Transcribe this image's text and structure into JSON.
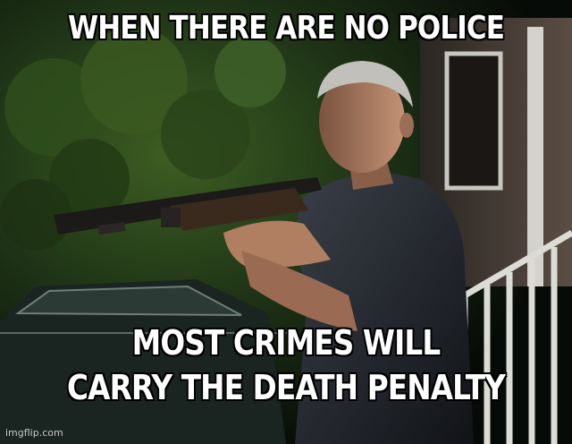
{
  "meme": {
    "top_text": "WHEN THERE ARE NO POLICE",
    "bottom_text_line1": "MOST CRIMES WILL",
    "bottom_text_line2": "CARRY THE DEATH PENALTY",
    "watermark": "imgflip.com"
  },
  "colors": {
    "caption_text": "#ffffff",
    "caption_outline": "#000000",
    "foliage": "#1f3a17",
    "shirt": "#1b1e24",
    "skin": "#a8795c",
    "hair": "#b9b7b2",
    "porch_rail": "#d9d9d4"
  }
}
